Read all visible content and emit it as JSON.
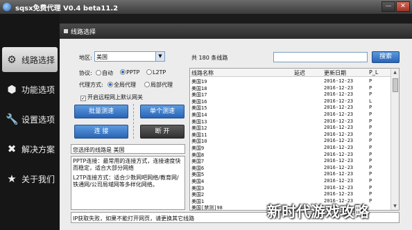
{
  "window": {
    "title": "sqsx免费代理 V0.4 beta11.2",
    "minimize": "—",
    "close": "✕"
  },
  "sidebar": {
    "items": [
      {
        "label": "线路选择",
        "icon": "gear-icon",
        "glyph": "⚙"
      },
      {
        "label": "功能选项",
        "icon": "hexagon-nut-icon",
        "glyph": "⬢"
      },
      {
        "label": "设置选项",
        "icon": "wrench-icon",
        "glyph": "🔧"
      },
      {
        "label": "解决方案",
        "icon": "toolbox-icon",
        "glyph": "✖"
      },
      {
        "label": "关于我们",
        "icon": "star-icon",
        "glyph": "★"
      }
    ]
  },
  "panel": {
    "title": "线路选择"
  },
  "filter": {
    "region_label": "地区:",
    "region_value": "美国",
    "protocol_label": "协议:",
    "protocol_options": [
      "自动",
      "PPTP",
      "L2TP"
    ],
    "protocol_selected": "PPTP",
    "mode_label": "代理方式:",
    "mode_options": [
      "全局代理",
      "局部代理"
    ],
    "mode_selected": "全局代理",
    "remote_gateway_label": "开启远程网上默认网关",
    "remote_gateway_checked": true
  },
  "buttons": {
    "batch_test": "批量测速",
    "single_test": "单个测速",
    "connect": "连 接",
    "disconnect": "断 开",
    "search": "搜索"
  },
  "selected_line": "您选择的线路是 美国",
  "info_text": {
    "pptp": "PPTP连接：最常用的连接方式，连接速度快而稳定，适合大部分网络",
    "l2tp": "L2TP连接方式：适合少数网吧网络/教育网/铁通网/公司局域网等多样化网络。"
  },
  "status": "IP获取失败，如果不能打开网页，请更换其它线路",
  "search": {
    "count_text": "共 180 条线路",
    "value": ""
  },
  "table": {
    "columns": [
      "线路名称",
      "延迟",
      "更新日期",
      "P_L"
    ],
    "rows": [
      [
        "美国19",
        "",
        "2016-12-23",
        "P"
      ],
      [
        "美国18",
        "",
        "2016-12-23",
        "P"
      ],
      [
        "美国17",
        "",
        "2016-12-23",
        "P"
      ],
      [
        "美国16",
        "",
        "2016-12-23",
        "L"
      ],
      [
        "美国15",
        "",
        "2016-12-23",
        "P"
      ],
      [
        "美国14",
        "",
        "2016-12-23",
        "P"
      ],
      [
        "美国13",
        "",
        "2016-12-23",
        "P"
      ],
      [
        "美国12",
        "",
        "2016-12-23",
        "P"
      ],
      [
        "美国11",
        "",
        "2016-12-23",
        "P"
      ],
      [
        "美国10",
        "",
        "2016-12-23",
        "P"
      ],
      [
        "美国9",
        "",
        "2016-12-23",
        "P"
      ],
      [
        "美国8",
        "",
        "2016-12-23",
        "P"
      ],
      [
        "美国7",
        "",
        "2016-12-23",
        "P"
      ],
      [
        "美国6",
        "",
        "2016-12-23",
        "P"
      ],
      [
        "美国5",
        "",
        "2016-12-23",
        "P"
      ],
      [
        "美国4",
        "",
        "2016-12-23",
        "P"
      ],
      [
        "美国3",
        "",
        "2016-12-23",
        "P"
      ],
      [
        "美国2",
        "",
        "2016-12-23",
        "P"
      ],
      [
        "美国1",
        "",
        "2016-12-23",
        "P"
      ],
      [
        "美国[禁测]98",
        "",
        "",
        ""
      ]
    ]
  },
  "watermark": "新时代游戏攻略"
}
